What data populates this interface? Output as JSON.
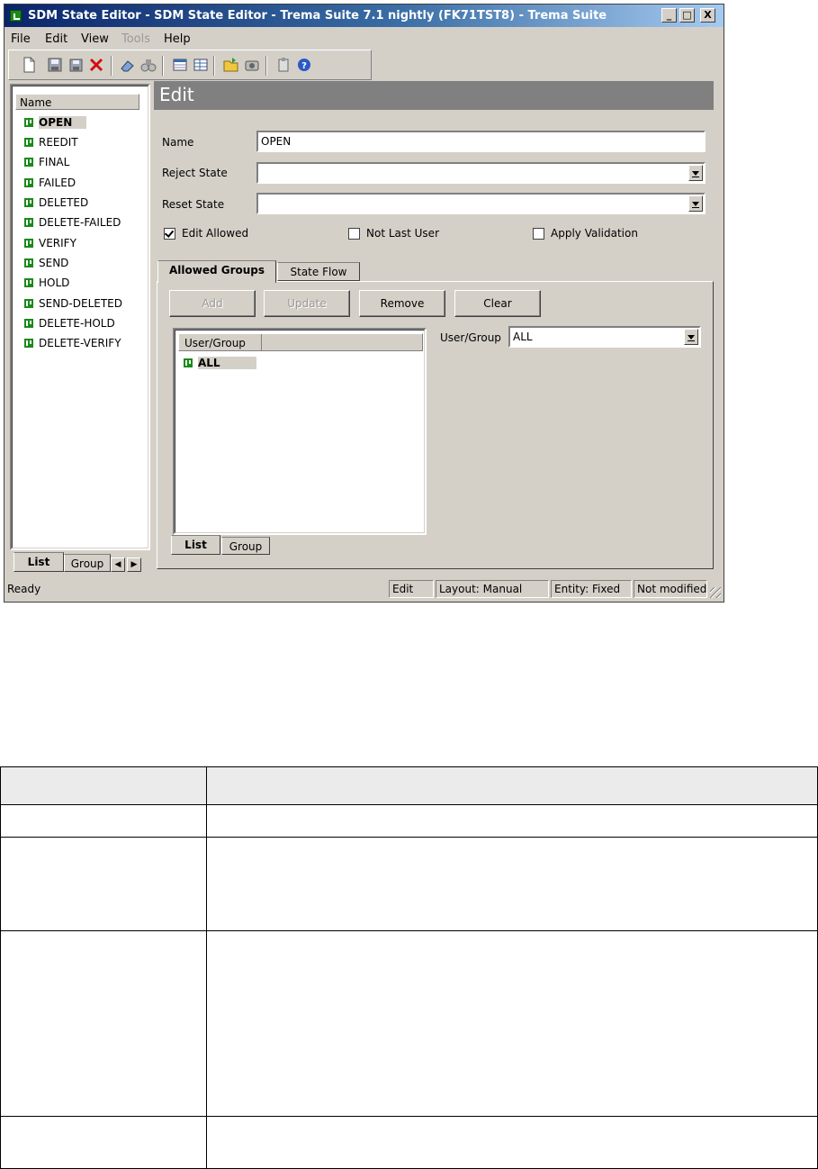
{
  "window": {
    "title": "SDM State Editor - SDM State Editor - Trema Suite 7.1 nightly (FK71TST8) - Trema Suite",
    "controls": {
      "minimize": "_",
      "maximize": "□",
      "close": "X"
    }
  },
  "menu": [
    {
      "label": "File",
      "enabled": true
    },
    {
      "label": "Edit",
      "enabled": true
    },
    {
      "label": "View",
      "enabled": true
    },
    {
      "label": "Tools",
      "enabled": false
    },
    {
      "label": "Help",
      "enabled": true
    }
  ],
  "toolbar": [
    "new-icon",
    "save-icon",
    "save-all-icon",
    "delete-icon",
    "eraser-icon",
    "find-icon",
    "grid-icon",
    "table-icon",
    "open-folder-icon",
    "camera-icon",
    "clipboard-icon",
    "help-icon"
  ],
  "left_panel": {
    "column_header": "Name",
    "items": [
      "OPEN",
      "REEDIT",
      "FINAL",
      "FAILED",
      "DELETED",
      "DELETE-FAILED",
      "VERIFY",
      "SEND",
      "HOLD",
      "SEND-DELETED",
      "DELETE-HOLD",
      "DELETE-VERIFY"
    ],
    "selected": "OPEN",
    "tabs": [
      "List",
      "Group"
    ]
  },
  "edit": {
    "heading": "Edit",
    "name_label": "Name",
    "name_value": "OPEN",
    "reject_label": "Reject State",
    "reject_value": "",
    "reset_label": "Reset State",
    "reset_value": "",
    "checks": {
      "edit_allowed": {
        "label": "Edit Allowed",
        "checked": true
      },
      "not_last_user": {
        "label": "Not Last User",
        "checked": false
      },
      "apply_validation": {
        "label": "Apply Validation",
        "checked": false
      }
    },
    "tabs": [
      "Allowed Groups",
      "State Flow"
    ],
    "buttons": {
      "add": "Add",
      "update": "Update",
      "remove": "Remove",
      "clear": "Clear"
    },
    "ug_column": "User/Group",
    "ug_items": [
      "ALL"
    ],
    "ug_tabs": [
      "List",
      "Group"
    ],
    "ug_field_label": "User/Group",
    "ug_field_value": "ALL"
  },
  "status": {
    "ready": "Ready",
    "panes": [
      "Edit",
      "Layout: Manual",
      "Entity: Fixed",
      "Not modified"
    ]
  },
  "colors": {
    "titlebar_start": "#0a246a",
    "titlebar_end": "#a6caf0",
    "window_face": "#d4d0c8",
    "state_icon": "#1a8a1a",
    "edit_header": "#808080"
  }
}
